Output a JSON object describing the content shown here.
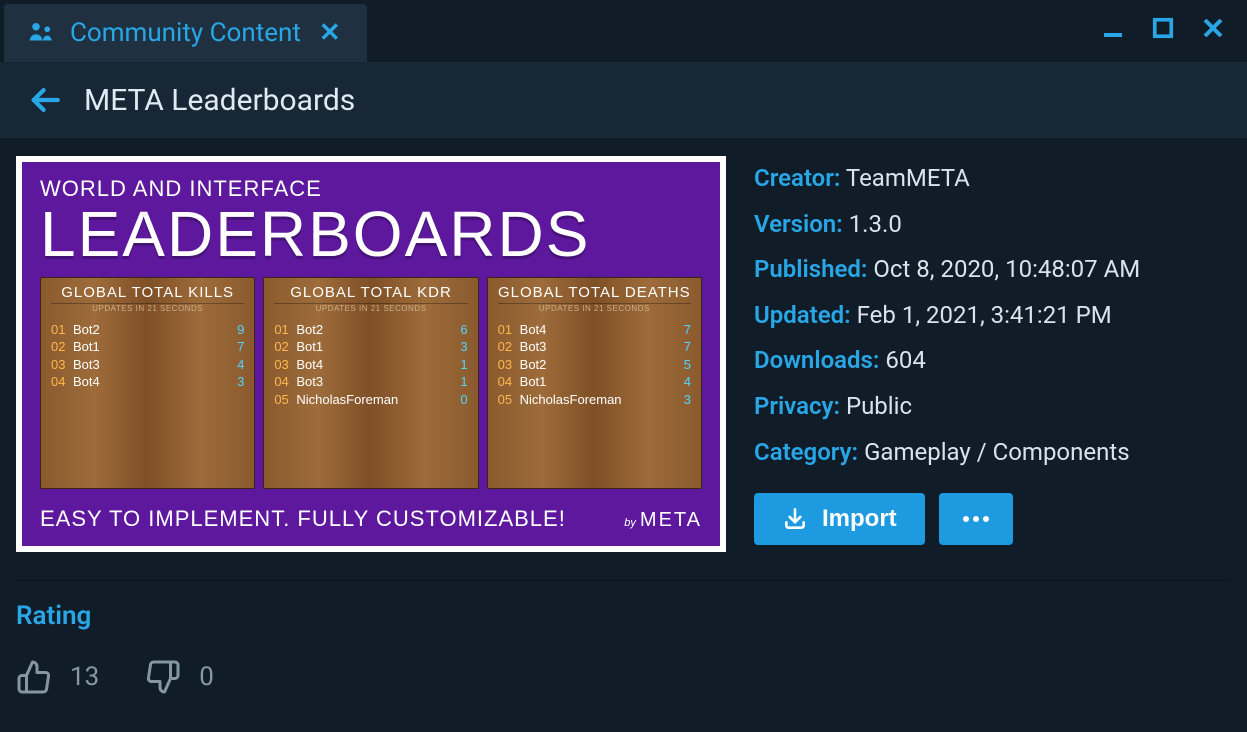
{
  "tab": {
    "label": "Community Content"
  },
  "header": {
    "title": "META Leaderboards"
  },
  "meta": {
    "creator_k": "Creator:",
    "creator_v": "TeamMETA",
    "version_k": "Version:",
    "version_v": "1.3.0",
    "published_k": "Published:",
    "published_v": "Oct 8, 2020, 10:48:07 AM",
    "updated_k": "Updated:",
    "updated_v": "Feb 1, 2021, 3:41:21 PM",
    "downloads_k": "Downloads:",
    "downloads_v": "604",
    "privacy_k": "Privacy:",
    "privacy_v": "Public",
    "category_k": "Category:",
    "category_v": "Gameplay / Components"
  },
  "actions": {
    "import": "Import"
  },
  "rating": {
    "heading": "Rating",
    "up": "13",
    "down": "0"
  },
  "preview": {
    "sup": "WORLD AND INTERFACE",
    "big": "LEADERBOARDS",
    "tag": "EASY TO IMPLEMENT. FULLY CUSTOMIZABLE!",
    "brand_by": "by",
    "brand": "META",
    "sub": "UPDATES IN 21 SECONDS",
    "boards": [
      {
        "title": "GLOBAL TOTAL KILLS",
        "rows": [
          {
            "rk": "01",
            "nm": "Bot2",
            "sc": "9"
          },
          {
            "rk": "02",
            "nm": "Bot1",
            "sc": "7"
          },
          {
            "rk": "03",
            "nm": "Bot3",
            "sc": "4"
          },
          {
            "rk": "04",
            "nm": "Bot4",
            "sc": "3"
          }
        ]
      },
      {
        "title": "GLOBAL TOTAL KDR",
        "rows": [
          {
            "rk": "01",
            "nm": "Bot2",
            "sc": "6"
          },
          {
            "rk": "02",
            "nm": "Bot1",
            "sc": "3"
          },
          {
            "rk": "03",
            "nm": "Bot4",
            "sc": "1"
          },
          {
            "rk": "04",
            "nm": "Bot3",
            "sc": "1"
          },
          {
            "rk": "05",
            "nm": "NicholasForeman",
            "sc": "0"
          }
        ]
      },
      {
        "title": "GLOBAL TOTAL DEATHS",
        "rows": [
          {
            "rk": "01",
            "nm": "Bot4",
            "sc": "7"
          },
          {
            "rk": "02",
            "nm": "Bot3",
            "sc": "7"
          },
          {
            "rk": "03",
            "nm": "Bot2",
            "sc": "5"
          },
          {
            "rk": "04",
            "nm": "Bot1",
            "sc": "4"
          },
          {
            "rk": "05",
            "nm": "NicholasForeman",
            "sc": "3"
          }
        ]
      }
    ]
  }
}
